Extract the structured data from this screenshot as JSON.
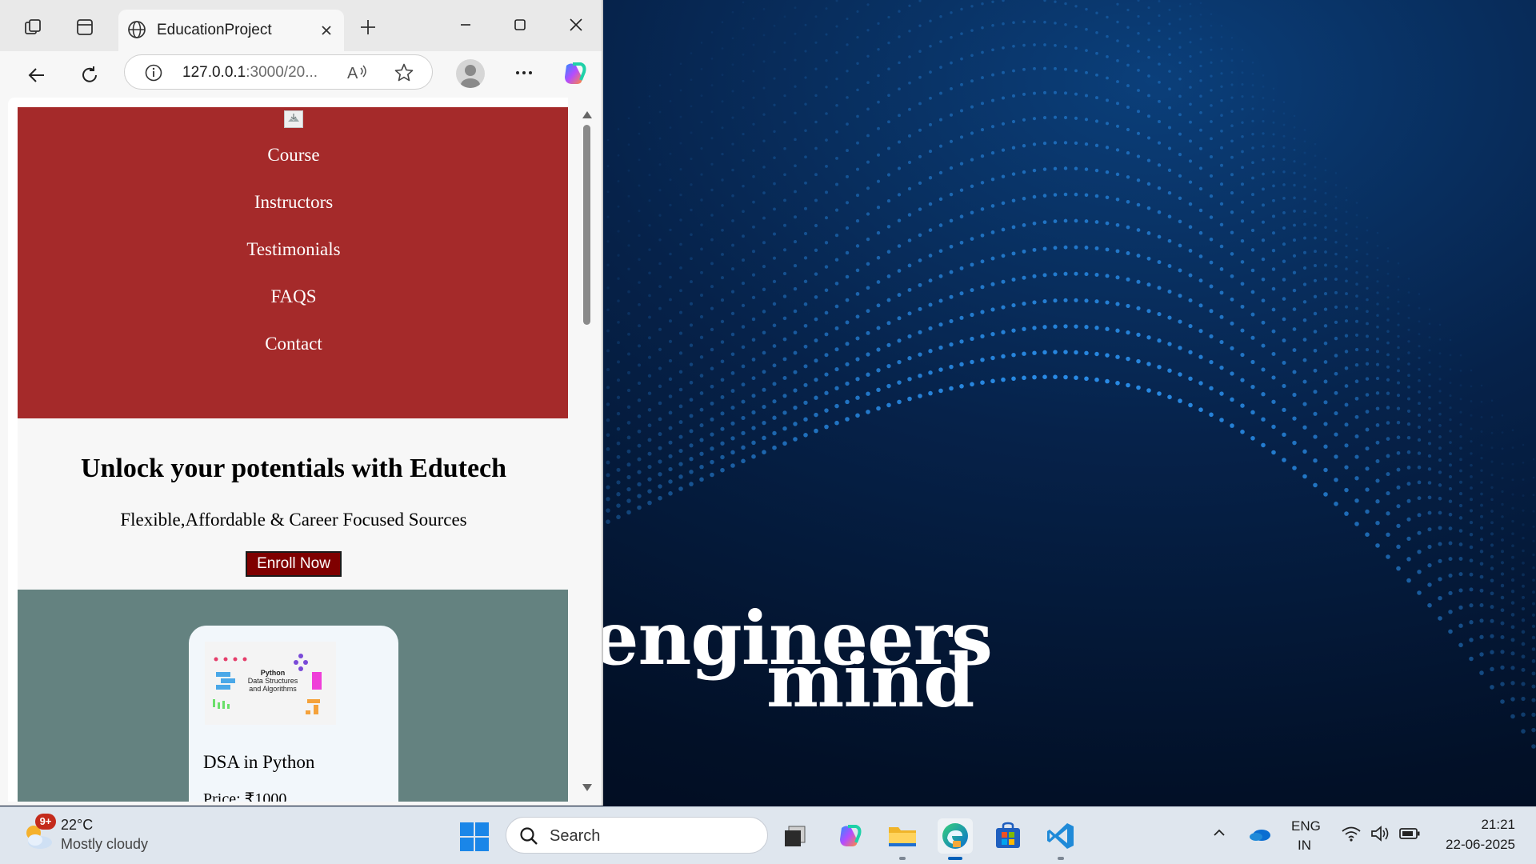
{
  "desktop": {
    "wallpaper_words": [
      "engineers",
      "mind"
    ]
  },
  "browser": {
    "tab": {
      "title": "EducationProject"
    },
    "address": {
      "host": "127.0.0.1",
      "rest": ":3000/20..."
    }
  },
  "site": {
    "nav": [
      "Course",
      "Instructors",
      "Testimonials",
      "FAQS",
      "Contact"
    ],
    "hero": {
      "title": "Unlock your potentials with Edutech",
      "subtitle": "Flexible,Affordable & Career Focused Sources",
      "cta": "Enroll Now"
    },
    "course_card": {
      "image_text": [
        "Python",
        "Data Structures",
        "and Algorithms"
      ],
      "title": "DSA in Python",
      "price": "Price: ₹1000"
    }
  },
  "taskbar": {
    "weather": {
      "badge": "9+",
      "temp": "22°C",
      "desc": "Mostly cloudy"
    },
    "search": {
      "label": "Search"
    },
    "language": {
      "line1": "ENG",
      "line2": "IN"
    },
    "clock": {
      "time": "21:21",
      "date": "22-06-2025"
    }
  },
  "colors": {
    "nav_bg": "#a52a2a",
    "hero_bg": "#f7f7f7",
    "cta_bg": "#7f0000",
    "courses_bg": "#648280",
    "accent": "#005fb8"
  },
  "icons": [
    "workspaces-icon",
    "tab-actions-icon",
    "globe-icon",
    "close-icon",
    "plus-icon",
    "minimize-icon",
    "maximize-icon",
    "window-close-icon",
    "back-icon",
    "refresh-icon",
    "info-icon",
    "read-aloud-icon",
    "favorite-star-icon",
    "profile-icon",
    "more-icon",
    "copilot-icon",
    "windows-start-icon",
    "search-icon",
    "task-view-icon",
    "copilot-app-icon",
    "file-explorer-icon",
    "edge-icon",
    "store-icon",
    "vscode-icon",
    "chevron-up-icon",
    "onedrive-icon",
    "wifi-icon",
    "volume-icon",
    "battery-icon"
  ]
}
